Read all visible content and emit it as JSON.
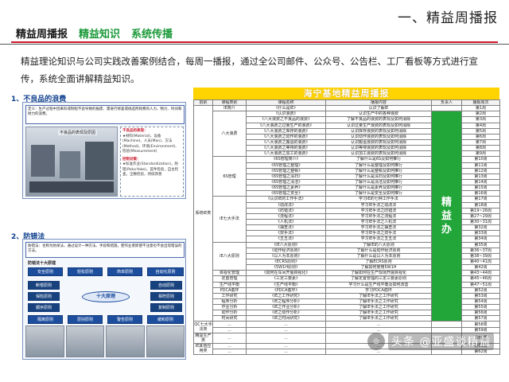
{
  "header": {
    "slide_title": "一、精益周播报",
    "tabs": [
      "精益周播报",
      "精益知识",
      "系统传播"
    ]
  },
  "intro": "精益理论知识与公司实践改善案例结合，每周一播报，通过全公司邮件、公众号、公告栏、工厂看板等方式进行宣传，系统全面讲解精益知识。",
  "left": {
    "section1": {
      "title": "1、不良品的浪费",
      "definition": "定义：生产过程中因来料或制程不良导致的报废、需进行修复或挑选所耗费的人力、物力、时间和财力的浪费。",
      "image_label": "不良品的表现及原因",
      "list_head_a": "不良品的表现：",
      "list_a": "★材料(Material)、设备(Machine)、人员(Man)、方法(Method)、环境(Environment)、检验(Measurement)",
      "list_head_b": "控制对策：",
      "list_b": "★标准作业(Standardization)，防错(Poka-Yoke)，首件检验，自主检查，全数检验，持续改善"
    },
    "section2": {
      "title": "2、防错法",
      "definition": "防错法：也称为防呆法，通过设计一种方法、手段和措施，使作业者即使不注意也不会出现错误的方法。",
      "subtitle": "防错法十大原理",
      "principles_top": [
        "安全原则",
        "轻松原则",
        "简单原则",
        "自动化原则"
      ],
      "principles_mid_left": [
        "断根原则",
        "保险原则"
      ],
      "principles_mid_right": [
        "自动原则",
        "相符原则"
      ],
      "center": "十大原理",
      "principles_low_left": [
        "顺序原则"
      ],
      "principles_low_right": [
        "复制原则"
      ],
      "principles_bottom": [
        "隔离原则",
        "层别原则",
        "警告原则",
        "缓和原则"
      ]
    }
  },
  "table": {
    "title": "海宁基地精益周播报",
    "headers": [
      "层别",
      "课程类别",
      "课程名称",
      "播报内容",
      "负责人",
      "播报周次"
    ],
    "category_main": "系统IE类",
    "owner": "精益办",
    "rows": [
      {
        "module": "IE简介",
        "course": "《什么是IE》",
        "content": "认识了解IE",
        "week": "第1周"
      },
      {
        "module": "八大浪费",
        "course": "《认识浪费》",
        "content": "认识生产中的各种浪费",
        "week": "第2周"
      },
      {
        "module": "",
        "course": "《八大浪费之不良品的浪费》",
        "content": "了解不良品的浪费的表现及如何消除",
        "week": "第3周"
      },
      {
        "module": "",
        "course": "《八大浪费之过量生产的浪费》",
        "content": "认识过量生产浪费的表现及如何消除",
        "week": "第4周"
      },
      {
        "module": "",
        "course": "《八大浪费之库存的浪费》",
        "content": "认识库存浪费的表现及如何消除",
        "week": "第5周"
      },
      {
        "module": "",
        "course": "《八大浪费之动作的浪费》",
        "content": "认识动作浪费的表现及如何消除",
        "week": "第6周"
      },
      {
        "module": "",
        "course": "《八大浪费之搬运的浪费》",
        "content": "认识搬运浪费的表现及如何消除",
        "week": "第7周"
      },
      {
        "module": "",
        "course": "《八大浪费之等待的浪费》",
        "content": "认识等待浪费的表现及如何消除",
        "week": "第8周"
      },
      {
        "module": "",
        "course": "《八大浪费之加工的浪费》",
        "content": "认识加工浪费的表现及如何消除",
        "week": "第9周"
      },
      {
        "module": "6S管理",
        "course": "《6S管理简介》",
        "content": "了解什么是6S及如何推行",
        "week": "第10周"
      },
      {
        "module": "",
        "course": "《6S管理之整理》",
        "content": "了解什么是整理及如何推行",
        "week": "第11周"
      },
      {
        "module": "",
        "course": "《6S管理之整顿》",
        "content": "了解什么是整顿及如何推行",
        "week": "第12周"
      },
      {
        "module": "",
        "course": "《6S管理之清扫》",
        "content": "了解什么是清扫及如何推行",
        "week": "第13周"
      },
      {
        "module": "",
        "course": "《6S管理之清洁》",
        "content": "了解什么是清洁及如何推行",
        "week": "第14周"
      },
      {
        "module": "",
        "course": "《6S管理之素养》",
        "content": "了解什么是素养及如何推行",
        "week": "第15周"
      },
      {
        "module": "",
        "course": "《6S管理之安全》",
        "content": "了解什么是安全及如何推行",
        "week": "第16周"
      },
      {
        "module": "IE七大手法",
        "course": "《认识IE的工作手法》",
        "content": "学习IE的七种工作手法",
        "week": "第17周"
      },
      {
        "module": "",
        "course": "《动改法》",
        "content": "学习IE手法之动改法",
        "week": "第18周"
      },
      {
        "module": "",
        "course": "《防错法》",
        "content": "学习IE手法之防错法",
        "week": "第19~26周"
      },
      {
        "module": "",
        "course": "《流程法》",
        "content": "学习IE手法之流程法",
        "week": "第27~29周"
      },
      {
        "module": "",
        "course": "《人机法》",
        "content": "学习IE手法之人机法",
        "week": "第30~31周"
      },
      {
        "module": "",
        "course": "《抽查法》",
        "content": "学习IE手法之抽查法",
        "week": "第32周"
      },
      {
        "module": "",
        "course": "《双手法》",
        "content": "学习IE手法之双手法",
        "week": "第33周"
      },
      {
        "module": "",
        "course": "《五五法》",
        "content": "学习IE手法之五五法",
        "week": "第34周"
      },
      {
        "module": "IE八大原则",
        "course": "《IE八大原则》",
        "content": "了解IE的八大原则",
        "week": "第35周"
      },
      {
        "module": "",
        "course": "《动作经济原则》",
        "content": "了解什么是动作经济原则",
        "week": "第36~37周"
      },
      {
        "module": "",
        "course": "《以人为本原则》",
        "content": "了解什么是以人为本原则",
        "week": "第38~39周"
      },
      {
        "module": "",
        "course": "《ECRS原则》",
        "content": "了解ECRS原则",
        "week": "第40~41周"
      },
      {
        "module": "",
        "course": "《5W1H原则》",
        "content": "了解如何使用5W1H",
        "week": "第42周"
      },
      {
        "module": "目视化管理",
        "course": "《如何在车间开展目视化》",
        "content": "了解如何在生产现场开展目视化",
        "week": "第43~44周"
      },
      {
        "module": "定置管理",
        "course": "《三定三要素》",
        "content": "了解定置管理的三定三要素原则",
        "week": "第45~46周"
      },
      {
        "module": "生产线平衡",
        "course": "《生产线平衡》",
        "content": "学习什么是生产线平衡及如何改善",
        "week": "第47~51周"
      },
      {
        "module": "PDCA循环",
        "course": "《PDCA循环》",
        "content": "学习PDCA循环",
        "week": "第52周"
      },
      {
        "module": "工作研究",
        "course": "《IE之工作研究》",
        "content": "了解IE手法之工作研究",
        "week": "第53周"
      },
      {
        "module": "程序分析",
        "course": "《IE之程序分析》",
        "content": "了解IE手法之工作研究",
        "week": "第54周"
      },
      {
        "module": "作业分析",
        "course": "《IE之作业分析》",
        "content": "了解IE手法之工作研究",
        "week": "第55周"
      },
      {
        "module": "动作分析",
        "course": "《IE之动作分析》",
        "content": "了解IE手法之工作研究",
        "week": "第56周"
      },
      {
        "module": "时间研究",
        "course": "《IE之时间研究》",
        "content": "了解IE手法之工作研究",
        "week": "第57周"
      },
      {
        "module": "...",
        "course": "...",
        "content": "...",
        "week": "第58周"
      },
      {
        "module": "...",
        "course": "...",
        "content": "...",
        "week": "第59周"
      },
      {
        "module": "...",
        "course": "...",
        "content": "...",
        "week": "第60周"
      },
      {
        "module": "...",
        "course": "...",
        "content": "...",
        "week": "第61周"
      },
      {
        "module": "...",
        "course": "...",
        "content": "...",
        "week": "第62周"
      }
    ],
    "sub_categories": [
      "QC七大手法类",
      "精益生产类",
      "IE其他应用类"
    ]
  },
  "watermark": {
    "text": "头条 @亚盛谈精益",
    "icon": "logo-icon"
  },
  "colors": {
    "accent_red": "#c9182c",
    "tab_green": "#1c9a3a",
    "table_title_yellow": "#ffd400",
    "owner_green": "#22a63a",
    "section_blue": "#0d3f8c"
  }
}
